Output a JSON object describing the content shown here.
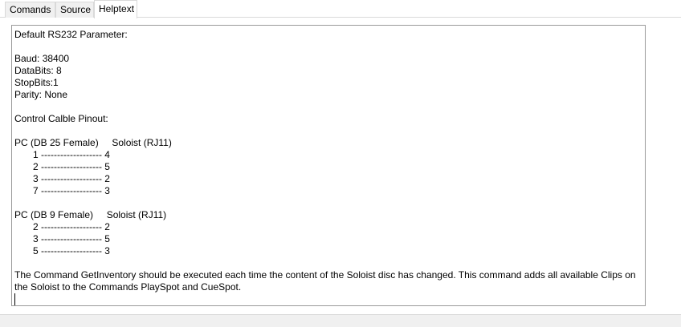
{
  "tabs": [
    {
      "label": "Comands",
      "active": false
    },
    {
      "label": "Source",
      "active": false
    },
    {
      "label": "Helptext",
      "active": true
    }
  ],
  "helptext": {
    "heading": "Default RS232 Parameter:",
    "baud": "Baud: 38400",
    "databits": "DataBits: 8",
    "stopbits": "StopBits:1",
    "parity": "Parity: None",
    "pinout_heading": "Control Calble Pinout:",
    "db25_header": "PC (DB 25 Female)     Soloist (RJ11)",
    "db25_rows": [
      "1 ------------------- 4",
      "2 ------------------- 5",
      "3 ------------------- 2",
      "7 ------------------- 3"
    ],
    "db9_header": "PC (DB 9 Female)     Soloist (RJ11)",
    "db9_rows": [
      "2 ------------------- 2",
      "3 ------------------- 5",
      "5 ------------------- 3"
    ],
    "note": "The Command GetInventory should be executed each time the content of the Soloist disc has changed. This command adds all available Clips on the Soloist to the Commands PlaySpot and CueSpot."
  }
}
